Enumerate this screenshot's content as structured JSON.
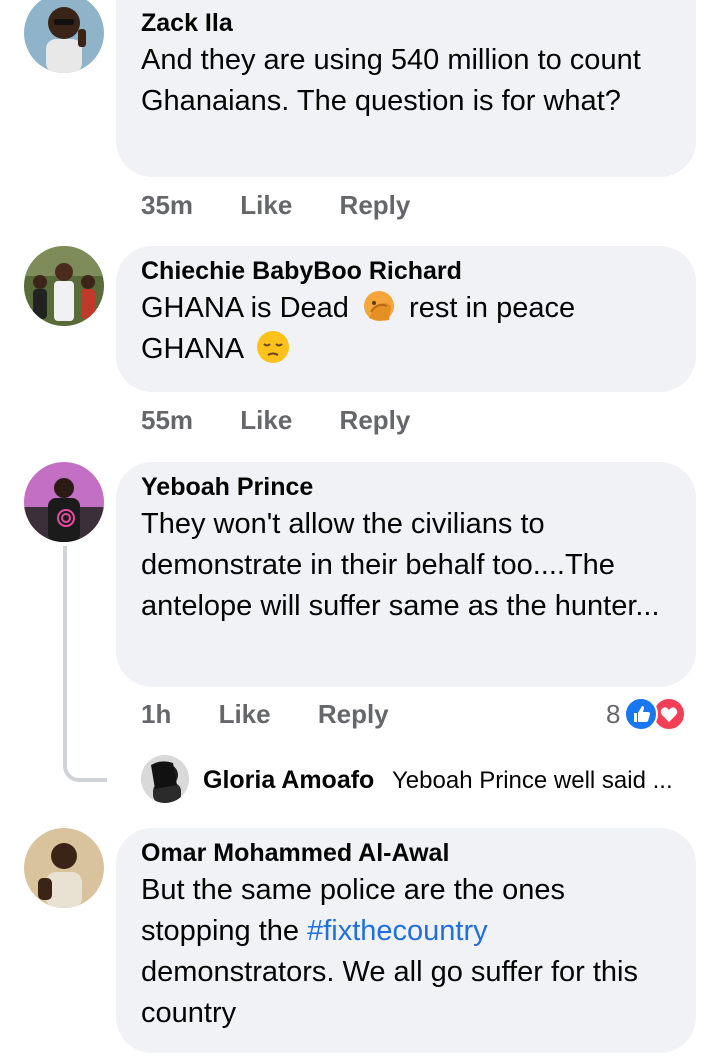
{
  "comments": [
    {
      "author": "Zack Ila",
      "text": "And they are using 540 million to count Ghanaians. The question is for what?",
      "time": "35m",
      "like_label": "Like",
      "reply_label": "Reply"
    },
    {
      "author": "Chiechie BabyBoo Richard",
      "text_part1": "GHANA is Dead",
      "emoji1": "face-palm-emoji",
      "text_part2": "rest in peace",
      "text_part3": "GHANA",
      "emoji2": "pensive-face-emoji",
      "time": "55m",
      "like_label": "Like",
      "reply_label": "Reply"
    },
    {
      "author": "Yeboah Prince",
      "text": "They won't allow the civilians to demonstrate in their behalf too....The antelope will suffer same as the hunter...",
      "time": "1h",
      "like_label": "Like",
      "reply_label": "Reply",
      "reaction_count": "8",
      "reaction_icons": [
        "like-reaction-icon",
        "love-reaction-icon"
      ],
      "reply_preview": {
        "author": "Gloria Amoafo",
        "text": "Yeboah Prince well said ..."
      }
    },
    {
      "author": "Omar Mohammed Al-Awal",
      "text_before": "But the same police are the ones stopping the",
      "hashtag": "#fixthecountry",
      "text_after": "demonstrators. We all go suffer for this country"
    }
  ],
  "colors": {
    "bubble": "#f0f2f5",
    "meta_text": "#65676b",
    "link": "#216fdb",
    "like_blue": "#1877f2",
    "love_red": "#f33e58"
  }
}
